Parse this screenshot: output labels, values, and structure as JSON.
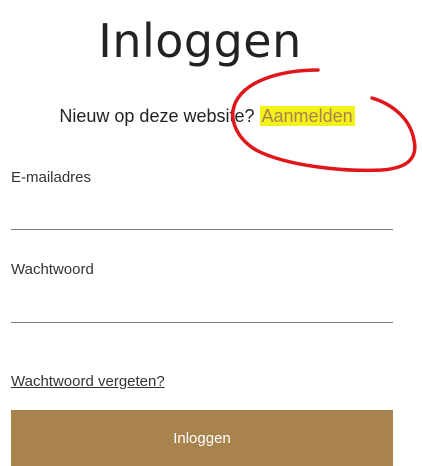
{
  "page": {
    "title": "Inloggen"
  },
  "signup": {
    "prompt": "Nieuw op deze website?",
    "link_label": "Aanmelden"
  },
  "form": {
    "email_label": "E-mailadres",
    "email_value": "",
    "password_label": "Wachtwoord",
    "password_value": ""
  },
  "forgot_password_label": "Wachtwoord vergeten?",
  "submit_label": "Inloggen",
  "colors": {
    "accent": "#a8834e",
    "highlight": "#f4f11a",
    "annotation": "#e0161b"
  }
}
